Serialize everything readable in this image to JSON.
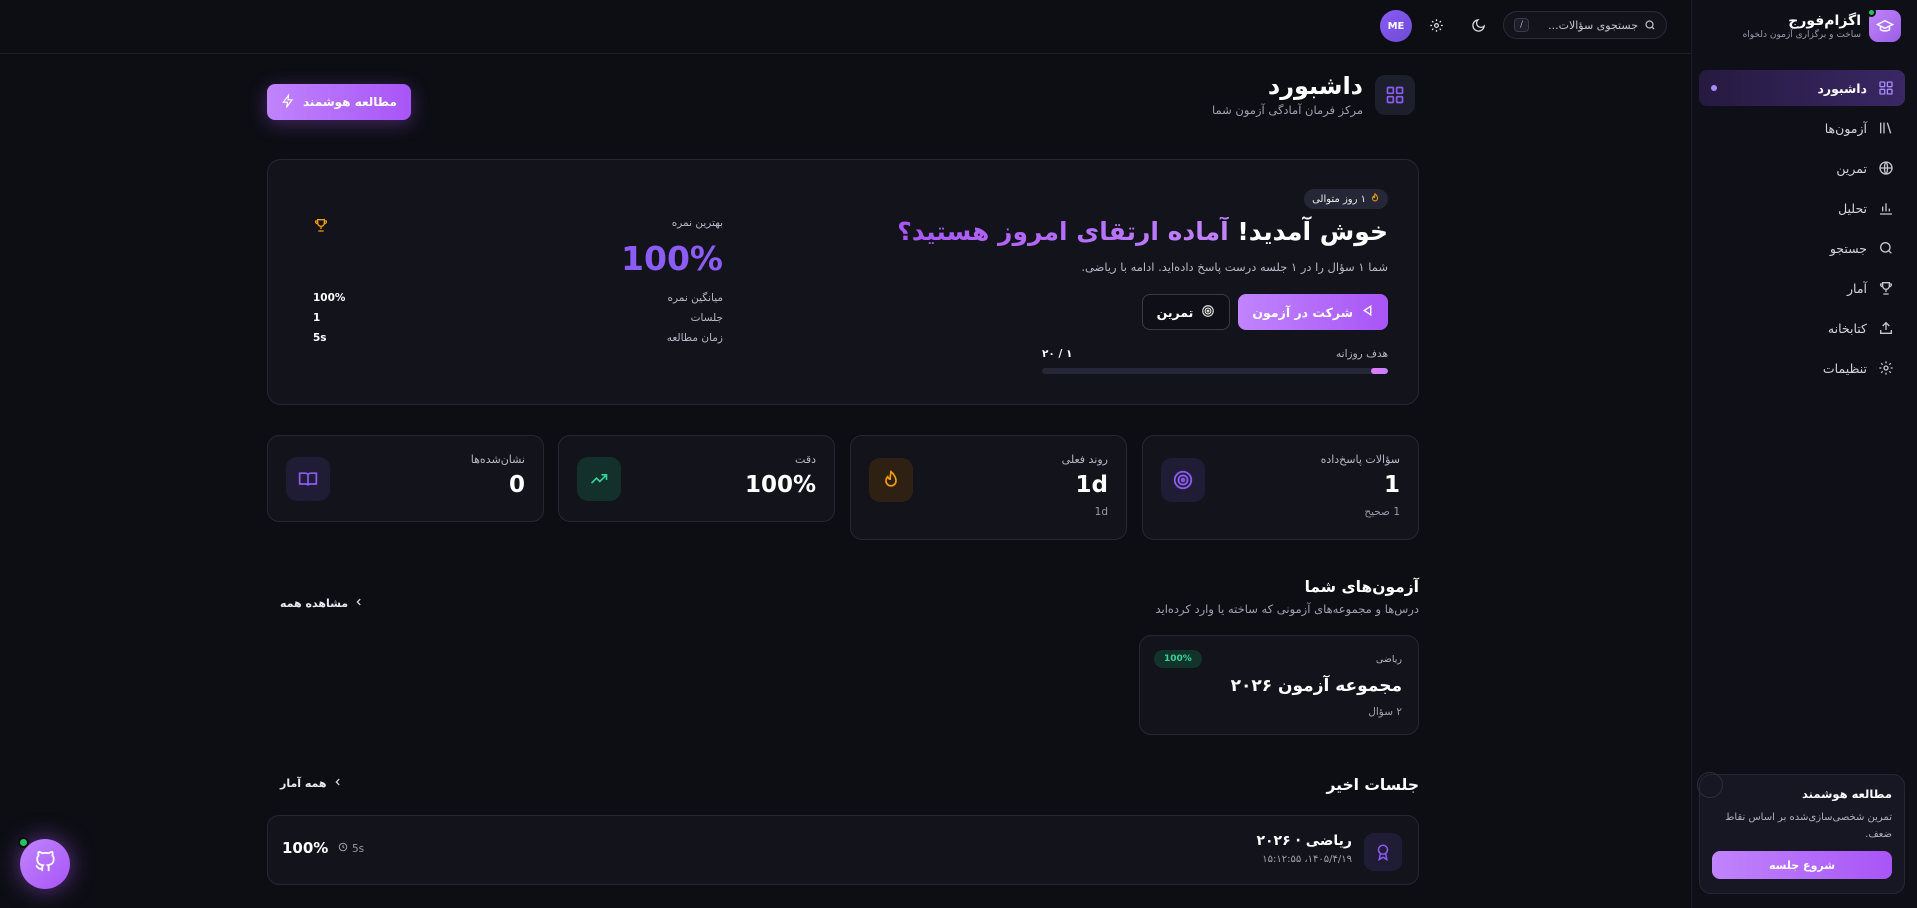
{
  "app": {
    "name": "اگزام‌فورج",
    "tagline": "ساخت و برگزاری آزمون دلخواه"
  },
  "topbar": {
    "search_placeholder": "جستجوی سؤالات...",
    "search_shortcut": "/",
    "avatar_initials": "ME"
  },
  "sidebar": {
    "items": [
      {
        "label": "داشبورد",
        "icon": "grid-icon"
      },
      {
        "label": "آزمون‌ها",
        "icon": "library-icon"
      },
      {
        "label": "تمرین",
        "icon": "globe-icon"
      },
      {
        "label": "تحلیل",
        "icon": "bar-chart-icon"
      },
      {
        "label": "جستجو",
        "icon": "search-icon"
      },
      {
        "label": "آمار",
        "icon": "trophy-icon"
      },
      {
        "label": "کتابخانه",
        "icon": "upload-icon"
      },
      {
        "label": "تنظیمات",
        "icon": "gear-icon"
      }
    ],
    "promo": {
      "title": "مطالعه هوشمند",
      "description": "تمرین شخصی‌سازی‌شده بر اساس نقاط ضعف.",
      "button": "شروع جلسه"
    }
  },
  "header": {
    "title": "داشبورد",
    "subtitle": "مرکز فرمان آمادگی آزمون شما",
    "smart_button": "مطالعه هوشمند"
  },
  "hero": {
    "streak": "۱ روز متوالی",
    "welcome": "خوش آمدید!",
    "welcome_accent": "آماده ارتقای امروز هستید؟",
    "description": "شما ۱ سؤال را در ۱ جلسه درست پاسخ داده‌اید. ادامه با ریاضی.",
    "primary_button": "شرکت در آزمون",
    "secondary_button": "تمرین",
    "goal_label": "هدف روزانه",
    "goal_value": "۱ / ۲۰",
    "goal_progress": 0.05,
    "best_label": "بهترین نمره",
    "best_value": "100%",
    "stats": [
      {
        "label": "میانگین نمره",
        "value": "100%"
      },
      {
        "label": "جلسات",
        "value": "1"
      },
      {
        "label": "زمان مطالعه",
        "value": "5s"
      }
    ]
  },
  "stats": [
    {
      "label": "سؤالات پاسخ‌داده",
      "value": "1",
      "sub": "1 صحیح",
      "icon": "target-icon"
    },
    {
      "label": "روند فعلی",
      "value": "1d",
      "sub": "1d",
      "icon": "flame-icon"
    },
    {
      "label": "دقت",
      "value": "100%",
      "sub": "",
      "icon": "trending-up-icon"
    },
    {
      "label": "نشان‌شده‌ها",
      "value": "0",
      "sub": "",
      "icon": "book-icon"
    }
  ],
  "exams": {
    "title": "آزمون‌های شما",
    "subtitle": "درس‌ها و مجموعه‌های آزمونی که ساخته یا وارد کرده‌اید",
    "view_all": "مشاهده همه",
    "items": [
      {
        "subject": "ریاضی",
        "badge": "100%",
        "name": "مجموعه آزمون ۲۰۲۶",
        "count": "۲ سؤال"
      }
    ]
  },
  "sessions": {
    "title": "جلسات اخیر",
    "view_all": "همه آمار",
    "items": [
      {
        "title": "ریاضی · ۲۰۲۶",
        "date": "۱۴۰۵/۴/۱۹، ۱۵:۱۲:۵۵",
        "score": "100%",
        "time": "5s"
      }
    ]
  },
  "colors": {
    "accent": "#a855f7",
    "accent_light": "#c084fc",
    "success": "#34d399",
    "warning": "#f59e0b",
    "background": "#0d0e14",
    "card": "#12131b"
  }
}
